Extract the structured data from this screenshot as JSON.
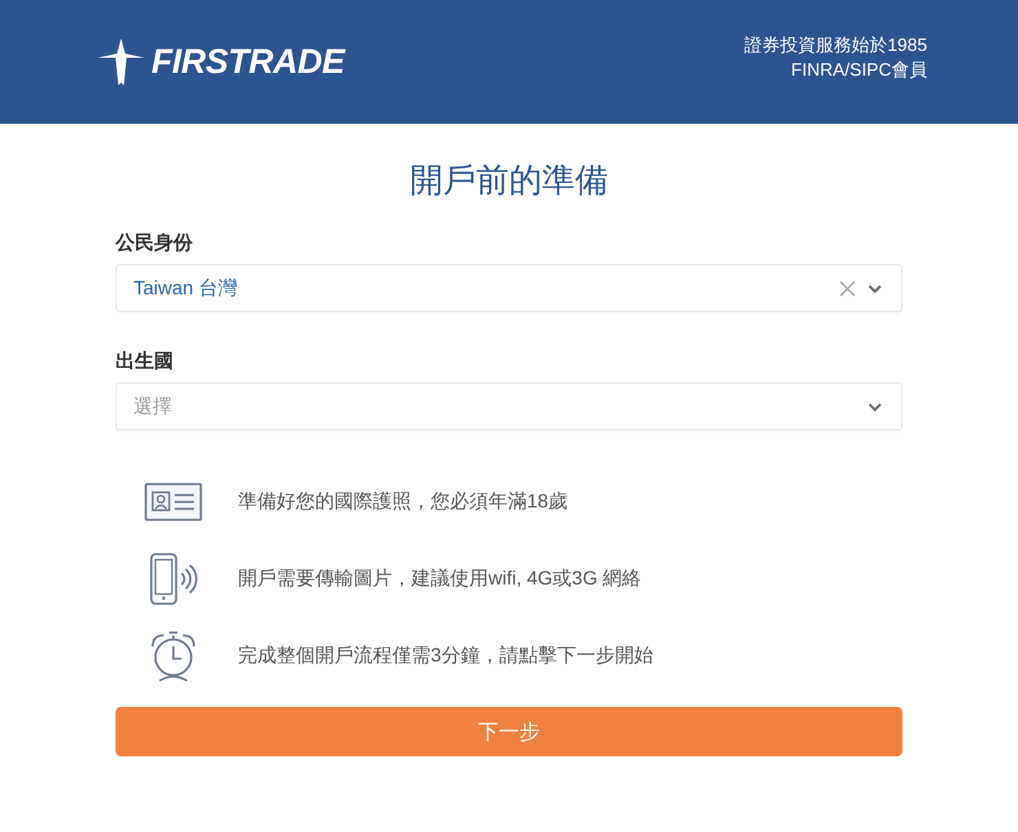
{
  "header": {
    "logo_text": "FIRSTRADE",
    "tagline_lines": [
      "證券投資服務始於1985",
      "FINRA/SIPC會員"
    ]
  },
  "title": "開戶前的準備",
  "fields": [
    {
      "label": "公民身份",
      "value": "Taiwan 台灣",
      "clearable": true
    },
    {
      "label": "出生國",
      "placeholder": "選擇",
      "clearable": false
    }
  ],
  "requirements": [
    {
      "kind": "id-card",
      "text": "準備好您的國際護照，您必須年滿18歲"
    },
    {
      "kind": "phone",
      "text": "開戶需要傳輸圖片，建議使用wifi, 4G或3G 網絡"
    },
    {
      "kind": "clock",
      "text": "完成整個開戶流程僅需3分鐘，請點擊下一步開始"
    }
  ],
  "next_button": "下一步"
}
